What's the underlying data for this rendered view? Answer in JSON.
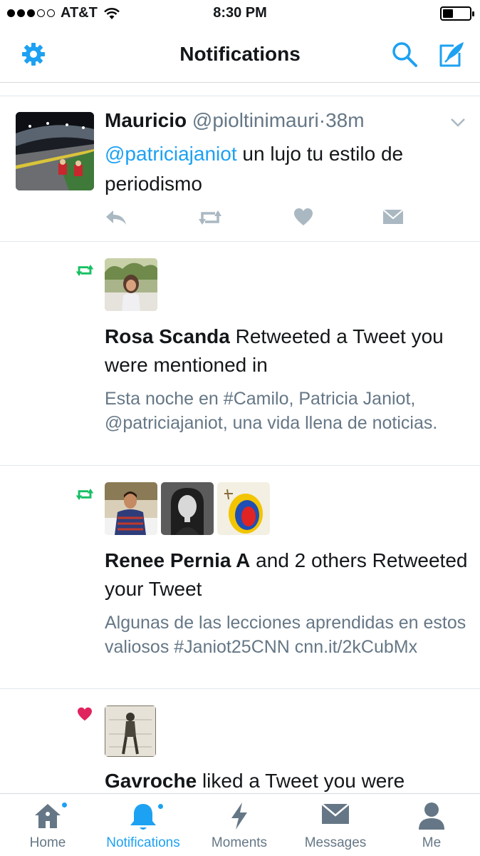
{
  "status_bar": {
    "carrier": "AT&T",
    "time": "8:30 PM",
    "signal_bars": 3,
    "battery_level": 0.3
  },
  "nav": {
    "title": "Notifications"
  },
  "tweet": {
    "name": "Mauricio",
    "handle": "@pioltinimauri",
    "separator": "·",
    "time": "38m",
    "mention": "@patriciajaniot",
    "text": " un lujo tu estilo de periodismo"
  },
  "notifications": [
    {
      "type": "retweet",
      "actor": "Rosa Scanda",
      "action": " Retweeted a Tweet you were mentioned in",
      "body": "Esta noche en #Camilo, Patricia Janiot, @patriciajaniot, una vida llena de noticias."
    },
    {
      "type": "retweet",
      "actor": "Renee Pernia A",
      "action": " and 2 others Retweeted your Tweet",
      "body": "Algunas de las lecciones aprendidas en estos valiosos #Janiot25CNN cnn.it/2kCubMx"
    },
    {
      "type": "like",
      "actor": "Gavroche",
      "action": " liked a Tweet you were"
    }
  ],
  "tabs": [
    {
      "label": "Home",
      "icon": "home-icon"
    },
    {
      "label": "Notifications",
      "icon": "bell-icon"
    },
    {
      "label": "Moments",
      "icon": "lightning-icon"
    },
    {
      "label": "Messages",
      "icon": "envelope-icon"
    },
    {
      "label": "Me",
      "icon": "person-icon"
    }
  ],
  "colors": {
    "accent": "#1da1f2",
    "retweet": "#17bf63",
    "like": "#e0245e",
    "secondary": "#657786"
  }
}
